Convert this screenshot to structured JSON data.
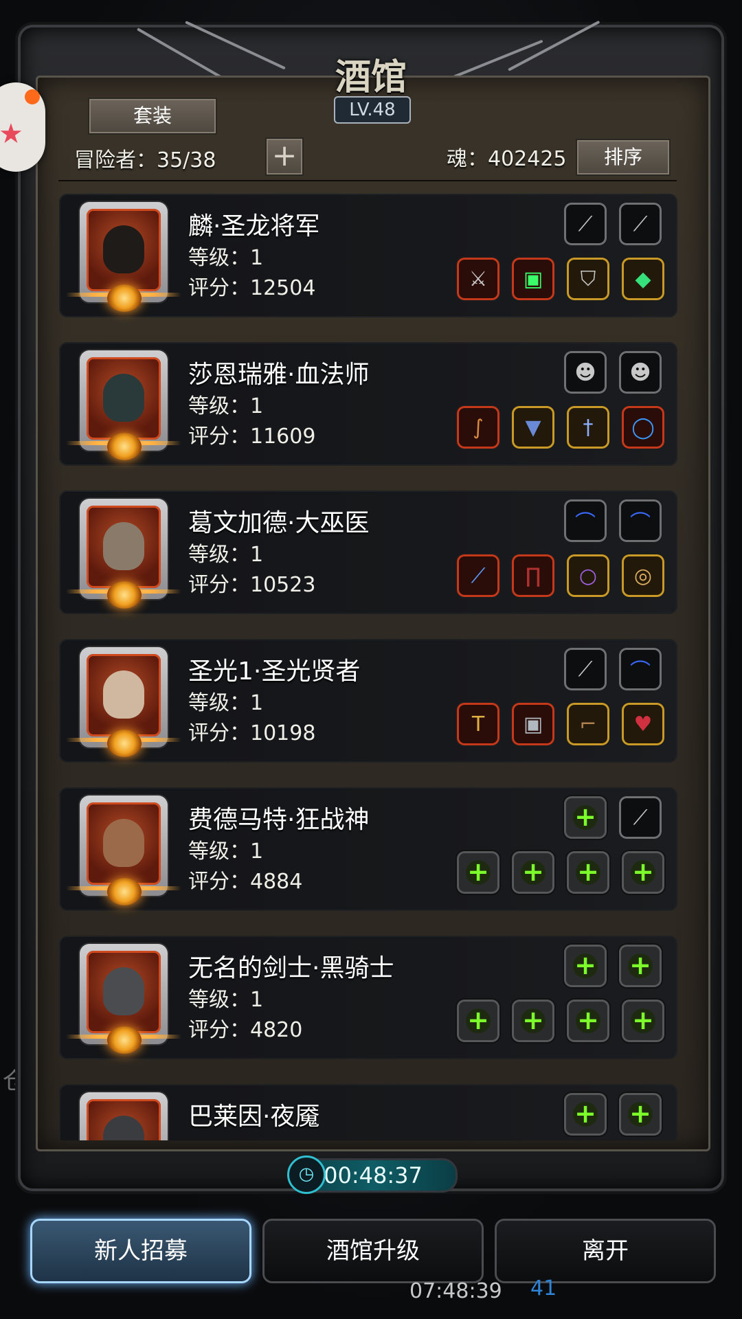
{
  "header": {
    "title": "酒馆",
    "level": "LV.48",
    "set_button": "套装",
    "adventurers_label": "冒险者：35/38",
    "add_icon": "plus-icon",
    "soul_label": "魂：402425",
    "sort_button": "排序"
  },
  "heroes": [
    {
      "name": "麟·圣龙将军",
      "level": "等级：1",
      "score": "评分：12504"
    },
    {
      "name": "莎恩瑞雅·血法师",
      "level": "等级：1",
      "score": "评分：11609"
    },
    {
      "name": "葛文加德·大巫医",
      "level": "等级：1",
      "score": "评分：10523"
    },
    {
      "name": "圣光1·圣光贤者",
      "level": "等级：1",
      "score": "评分：10198"
    },
    {
      "name": "费德马特·狂战神",
      "level": "等级：1",
      "score": "评分：4884"
    },
    {
      "name": "无名的剑士·黑骑士",
      "level": "等级：1",
      "score": "评分：4820"
    },
    {
      "name": "巴莱因·夜魇",
      "level": "",
      "score": ""
    }
  ],
  "timer": "00:48:37",
  "buttons": {
    "recruit": "新人招募",
    "upgrade": "酒馆升级",
    "leave": "离开"
  },
  "background": {
    "clock": "07:48:39",
    "count": "41",
    "side_char": "仓"
  }
}
